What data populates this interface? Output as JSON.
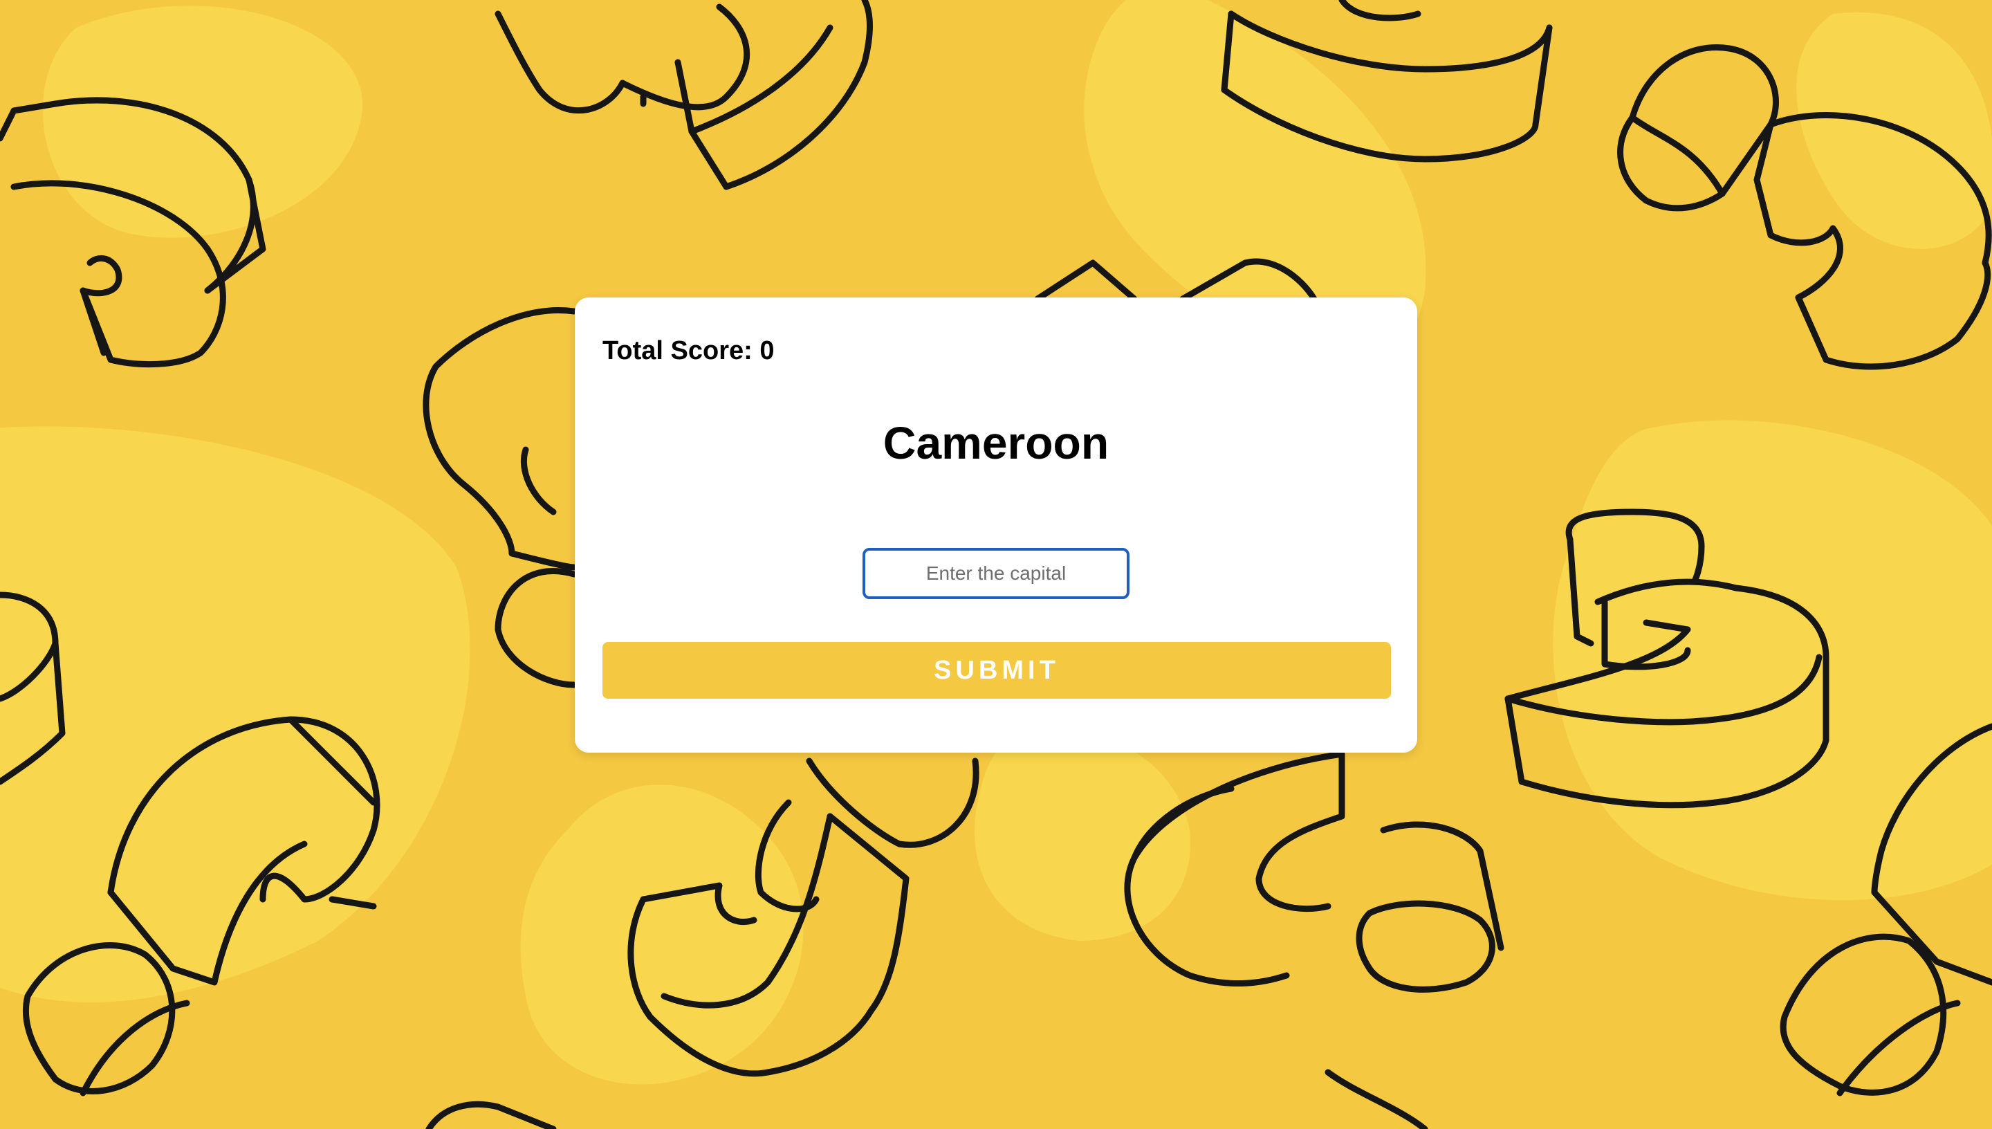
{
  "game": {
    "score_text": "Total Score: 0",
    "country": "Cameroon",
    "input_placeholder": "Enter the capital",
    "input_value": "",
    "submit_label": "SUBMIT"
  },
  "background": {
    "base_color": "#F5C842",
    "blob_color": "#F8D64D",
    "outline_color": "#161616",
    "pattern_icon": "question-mark-3d-outline-icon"
  },
  "colors": {
    "card": "#FFFFFF",
    "input_border": "#1F5FBF",
    "button": "#F5C842",
    "button_text": "#FFFFFF"
  }
}
